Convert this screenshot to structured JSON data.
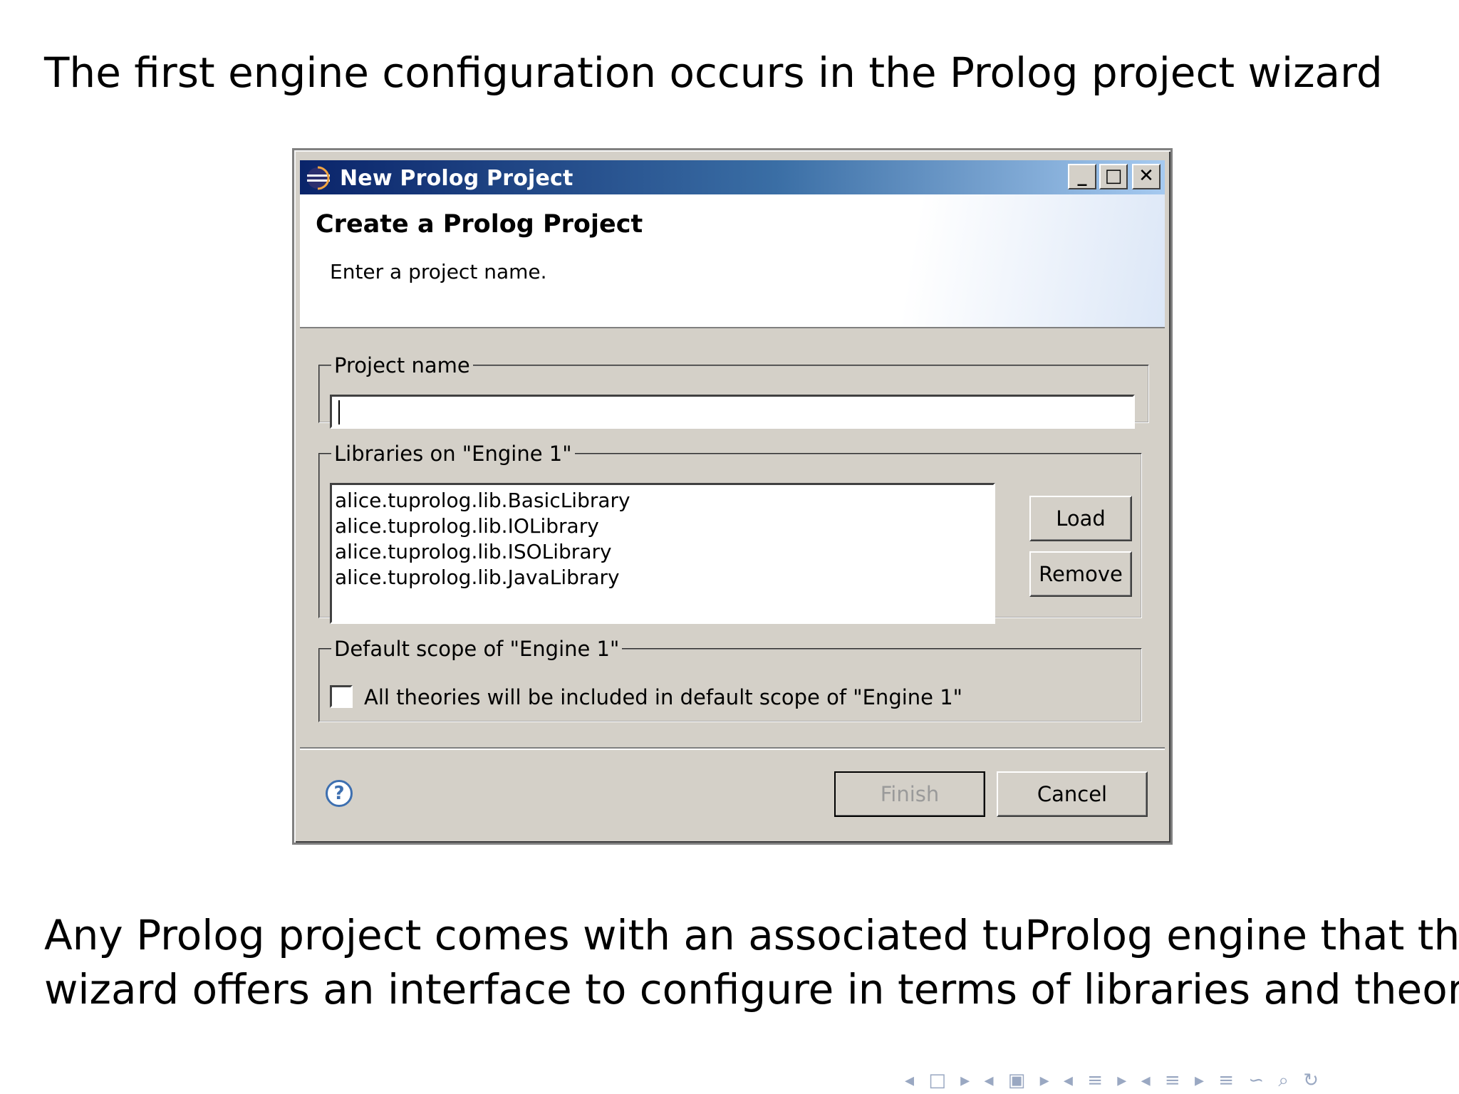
{
  "slide": {
    "heading": "The first engine configuration occurs in the Prolog project wizard",
    "caption_line1": "Any Prolog project comes with an associated tuProlog engine that the",
    "caption_line2": "wizard offers an interface to configure in terms of libraries and theories",
    "nav_symbols": "◂ □ ▸ ◂ ▣ ▸ ◂ ≡ ▸ ◂ ≡ ▸ ≡ ∽ ⌕ ↻"
  },
  "dialog": {
    "window_title": "New Prolog Project",
    "banner_title": "Create a Prolog Project",
    "banner_description": "Enter a project name.",
    "project_group_label": "Project name",
    "project_name_value": "",
    "libraries_group_label": "Libraries on \"Engine 1\"",
    "libraries": [
      "alice.tuprolog.lib.BasicLibrary",
      "alice.tuprolog.lib.IOLibrary",
      "alice.tuprolog.lib.ISOLibrary",
      "alice.tuprolog.lib.JavaLibrary"
    ],
    "load_label": "Load",
    "remove_label": "Remove",
    "scope_group_label": "Default scope of \"Engine 1\"",
    "scope_checkbox_label": "All theories will be included in default scope of \"Engine 1\"",
    "scope_checked": false,
    "finish_label": "Finish",
    "cancel_label": "Cancel",
    "help_symbol": "?",
    "min_symbol": "_",
    "max_symbol": "□",
    "close_symbol": "✕"
  },
  "colors": {
    "titlebar_start": "#0a246a",
    "titlebar_end": "#a6caf0",
    "dialog_face": "#d4d0c8",
    "nav_symbols": "#9aa8c2"
  }
}
